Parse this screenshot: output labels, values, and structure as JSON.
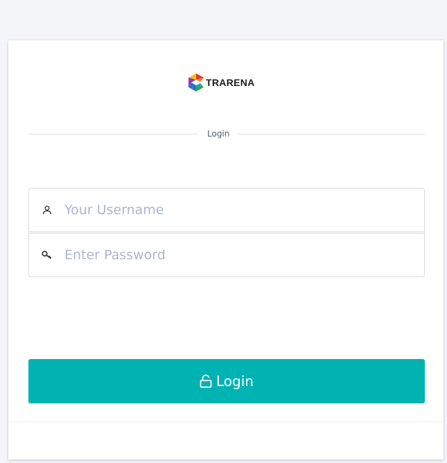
{
  "brand": {
    "name": "TRARENA",
    "colors": [
      "#f5c400",
      "#e8352b",
      "#8e3bb5",
      "#2f6fd8",
      "#2ca84a"
    ]
  },
  "login_section": {
    "title": "Login"
  },
  "form": {
    "username": {
      "icon": "user-icon",
      "placeholder": "Your Username",
      "value": ""
    },
    "password": {
      "icon": "key-icon",
      "placeholder": "Enter Password",
      "value": ""
    }
  },
  "actions": {
    "login_button": {
      "icon": "unlock-icon",
      "label": "Login",
      "color": "#00b3b3"
    }
  }
}
